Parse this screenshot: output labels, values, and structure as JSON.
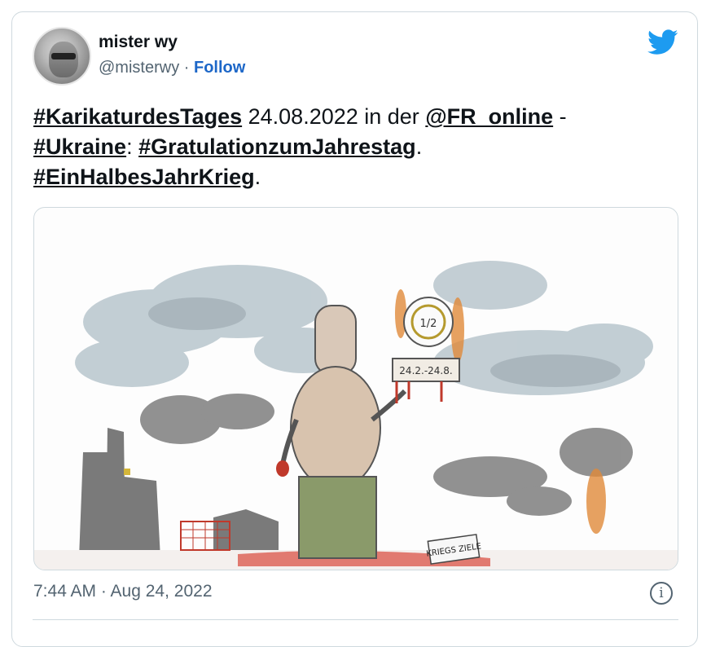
{
  "author": {
    "name": "mister wy",
    "handle": "@misterwy",
    "separator": "·",
    "follow_label": "Follow"
  },
  "tweet": {
    "hashtag_1": "#KarikaturdesTages",
    "text_1": " 24.08.2022 in der ",
    "mention": "@FR_online",
    "text_2": " -",
    "hashtag_2": "#Ukraine",
    "text_3": ": ",
    "hashtag_3": "#GratulationzumJahrestag",
    "text_4": ".",
    "hashtag_4": "#EinHalbesJahrKrieg",
    "text_5": "."
  },
  "media": {
    "sign_text": "24.2.-24.8.",
    "medal_text": "1/2",
    "ground_sign": "KRIEGS ZIELE"
  },
  "footer": {
    "timestamp": "7:44 AM · Aug 24, 2022",
    "info_glyph": "i"
  },
  "colors": {
    "accent": "#1d67c8",
    "twitter_blue": "#1d9bf0",
    "text_secondary": "#536471",
    "border": "#cfd9de"
  },
  "icons": {
    "brand": "twitter-bird-icon",
    "info": "info-icon"
  }
}
